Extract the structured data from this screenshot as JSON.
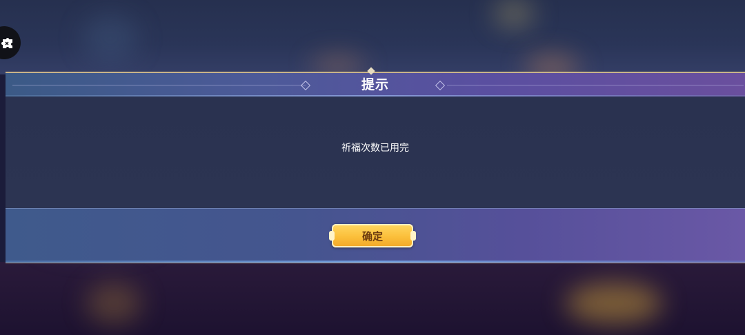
{
  "dialog": {
    "title": "提示",
    "message": "祈福次数已用完",
    "confirm_label": "确定"
  },
  "icons": {
    "side_toggle": "puzzle-icon"
  },
  "colors": {
    "title_text": "#ffffff",
    "button_gold": "#fbbf3a",
    "button_text": "#6b3a10",
    "header_gradient_start": "#3b5a86",
    "header_gradient_end": "#6a4f9e"
  }
}
